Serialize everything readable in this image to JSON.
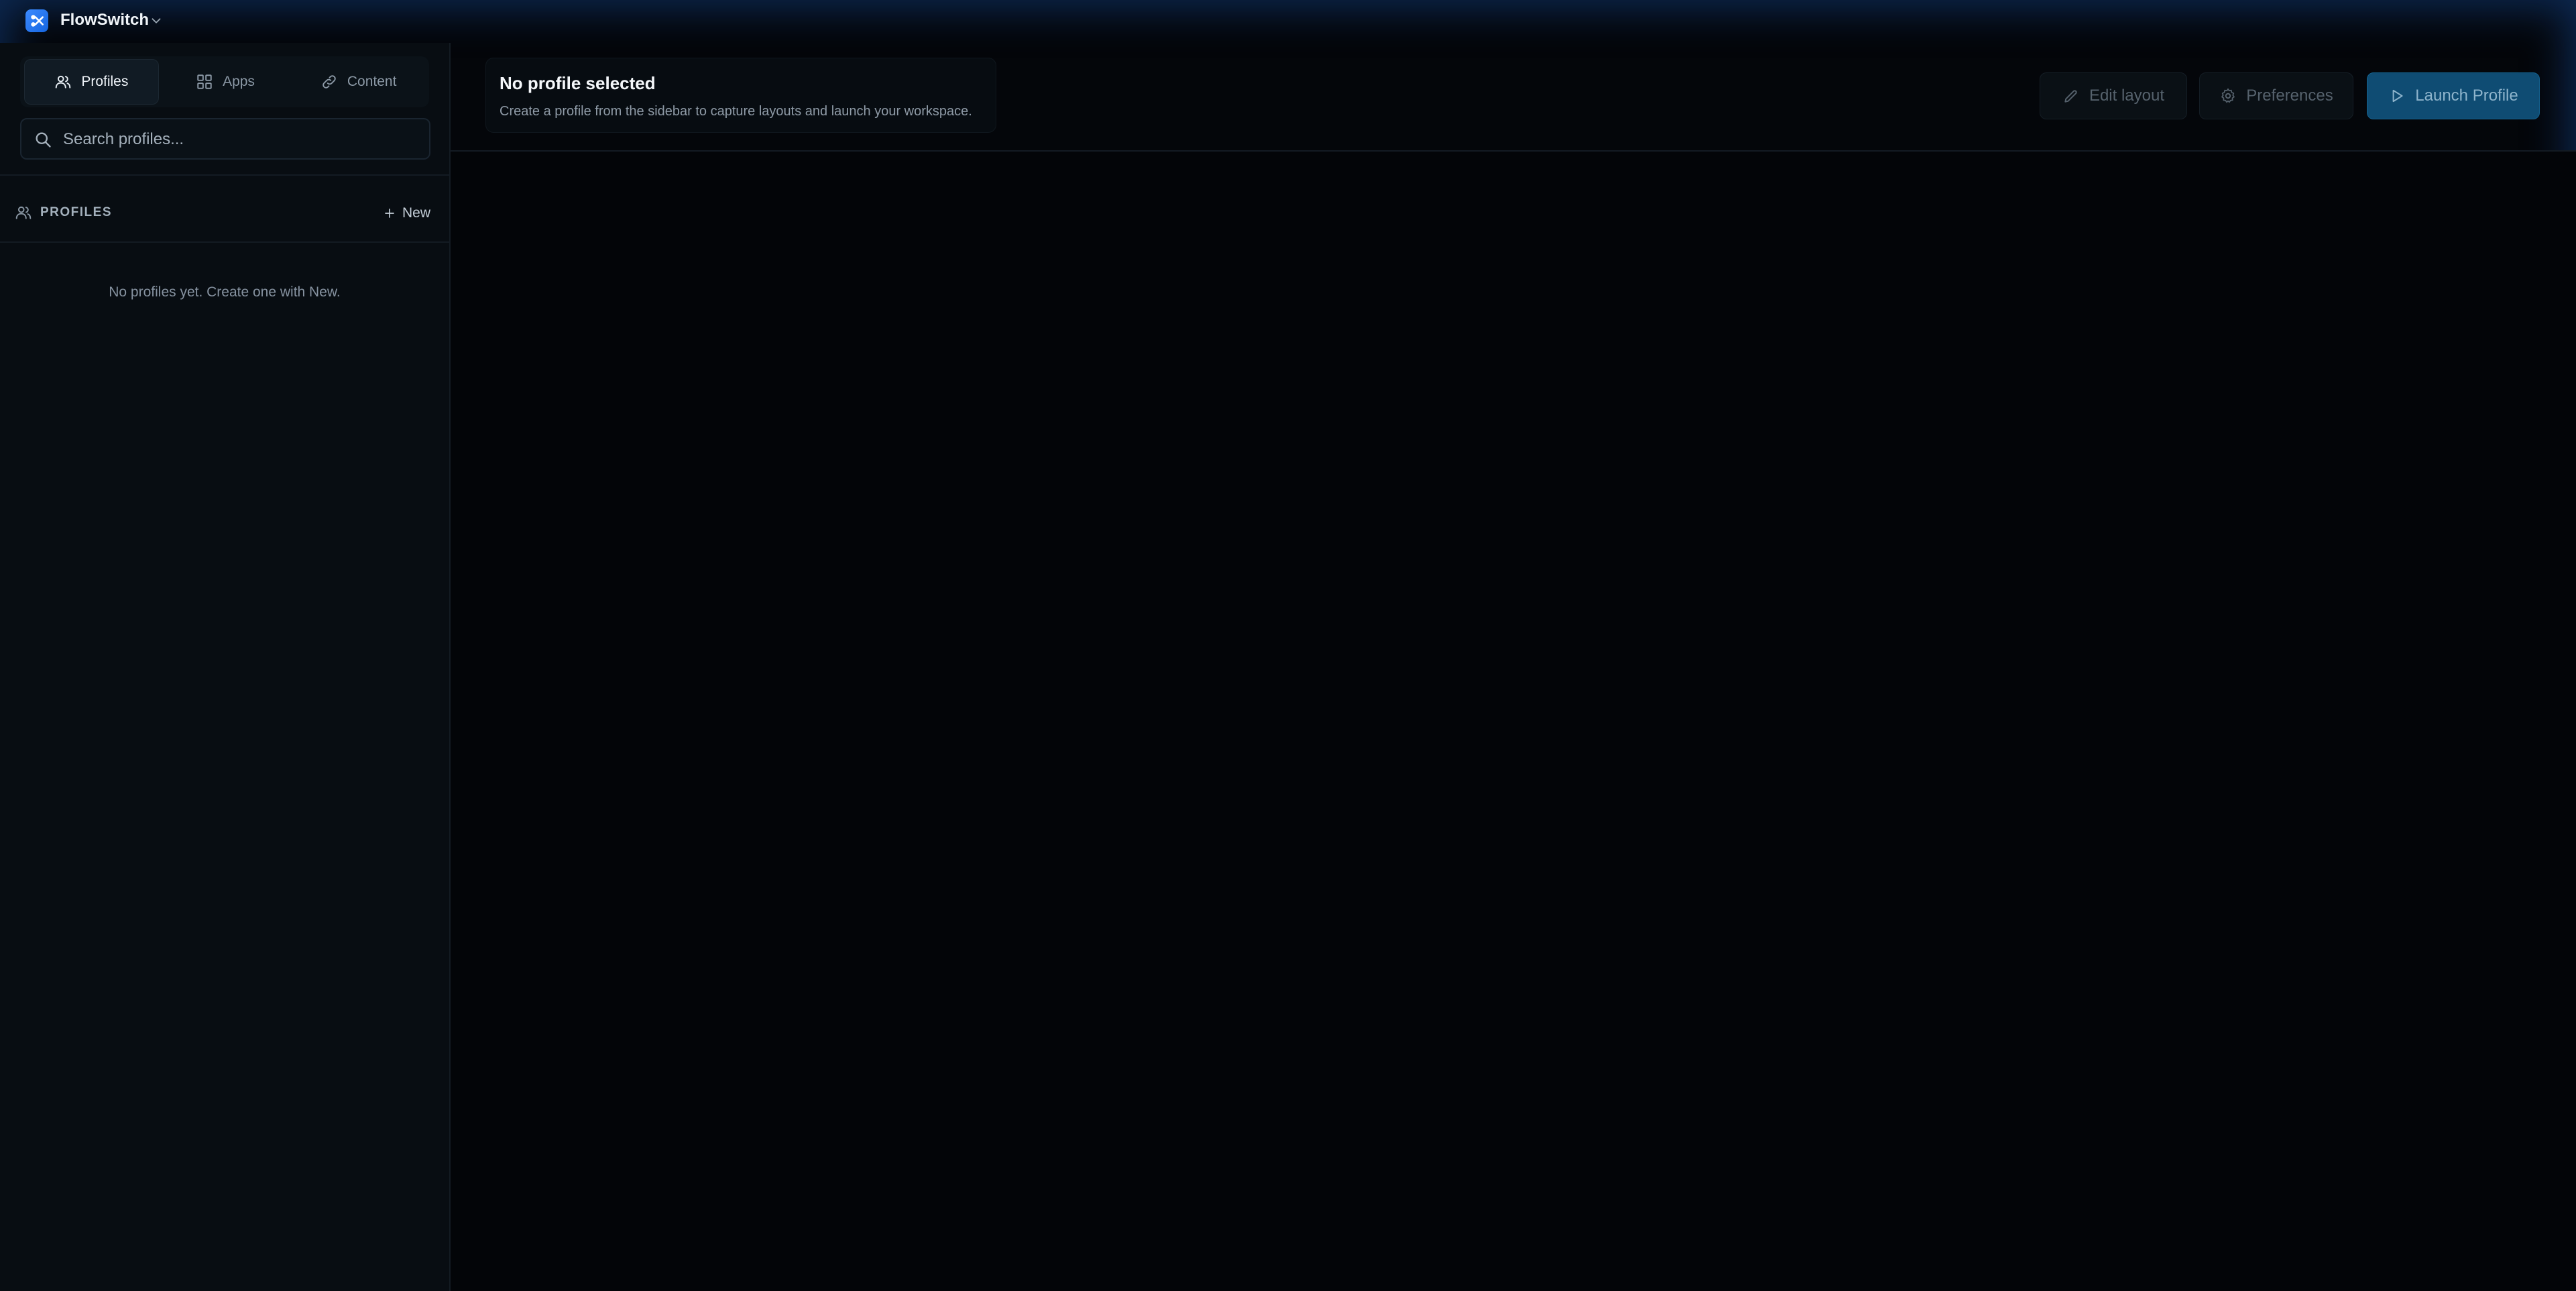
{
  "app": {
    "title": "FlowSwitch",
    "accent_color": "#2f7df0"
  },
  "sidebar": {
    "tabs": [
      {
        "label": "Profiles",
        "icon": "users-icon",
        "active": true
      },
      {
        "label": "Apps",
        "icon": "grid-icon",
        "active": false
      },
      {
        "label": "Content",
        "icon": "link-icon",
        "active": false
      }
    ],
    "search": {
      "placeholder": "Search profiles...",
      "value": ""
    },
    "section": {
      "label": "PROFILES",
      "new_label": "New"
    },
    "empty_text": "No profiles yet. Create one with New."
  },
  "main": {
    "title": "No profile selected",
    "subtitle": "Create a profile from the sidebar to capture layouts and launch your workspace.",
    "actions": {
      "edit_label": "Edit layout",
      "preferences_label": "Preferences",
      "launch_label": "Launch Profile"
    }
  }
}
